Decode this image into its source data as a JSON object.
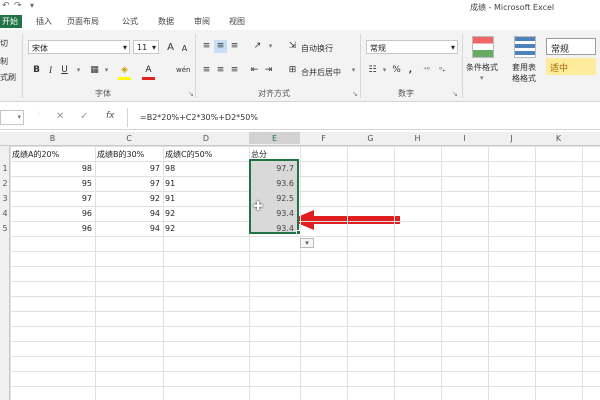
{
  "window": {
    "title": "成绩 - Microsoft Excel"
  },
  "tabs": [
    "开始",
    "插入",
    "页面布局",
    "公式",
    "数据",
    "审阅",
    "视图"
  ],
  "ribbon": {
    "clipboard": {
      "cut": "切",
      "copy": "制",
      "painter": "式刷"
    },
    "font": {
      "name": "宋体",
      "size": "11",
      "bold": "B",
      "italic": "I",
      "underline": "U",
      "grow": "A",
      "shrink": "A",
      "fontcolor": "A",
      "wen": "wén",
      "label": "字体"
    },
    "alignment": {
      "wrap": "自动换行",
      "merge": "合并后居中",
      "label": "对齐方式"
    },
    "number": {
      "format": "常规",
      "percent": "%",
      "comma": ",",
      "label": "数字"
    },
    "styles": {
      "cond": "条件格式",
      "table": "套用表格格式",
      "normal": "常规",
      "good": "适中"
    }
  },
  "formulabar": {
    "namebox": "",
    "cancel": "✕",
    "enter": "✓",
    "fx": "fx",
    "formula": "=B2*20%+C2*30%+D2*50%"
  },
  "columns": [
    "B",
    "C",
    "D",
    "E",
    "F",
    "G",
    "H",
    "I",
    "J",
    "K"
  ],
  "rows": [
    "1",
    "2",
    "3",
    "4",
    "5"
  ],
  "headers": {
    "b": "成绩A的20%",
    "c": "成绩B的30%",
    "d": "成绩C的50%",
    "e": "总分"
  },
  "data": [
    {
      "b": "98",
      "c": "97",
      "d": "98",
      "e": "97.7"
    },
    {
      "b": "95",
      "c": "97",
      "d": "91",
      "e": "93.6"
    },
    {
      "b": "97",
      "c": "92",
      "d": "91",
      "e": "92.5"
    },
    {
      "b": "96",
      "c": "94",
      "d": "92",
      "e": "93.4"
    },
    {
      "b": "96",
      "c": "94",
      "d": "92",
      "e": "93.4"
    }
  ],
  "colors": {
    "accent": "#217346",
    "arrow": "#e02020",
    "good_bg": "#ffeb9c",
    "good_fg": "#9c6500"
  }
}
